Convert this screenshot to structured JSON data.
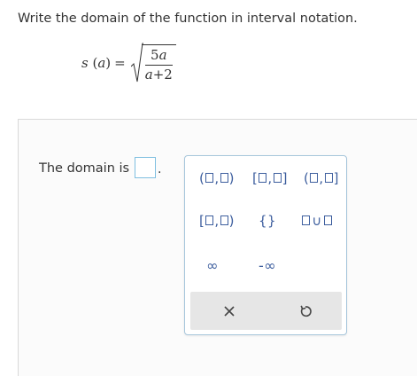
{
  "question": "Write the domain of the function in interval notation.",
  "formula": {
    "func": "s",
    "var": "a",
    "equals": "=",
    "numerator_coef": "5",
    "numerator_var": "a",
    "denominator_var": "a",
    "denominator_rest": "+2"
  },
  "answer": {
    "label": "The domain is",
    "value": "",
    "period": "."
  },
  "palette": {
    "infinity": "∞",
    "neg_infinity": "-∞",
    "empty_set": "{}",
    "union": "∪",
    "clear_icon": "close-icon",
    "undo_icon": "undo-icon",
    "accent_color": "#3d5e9e"
  }
}
